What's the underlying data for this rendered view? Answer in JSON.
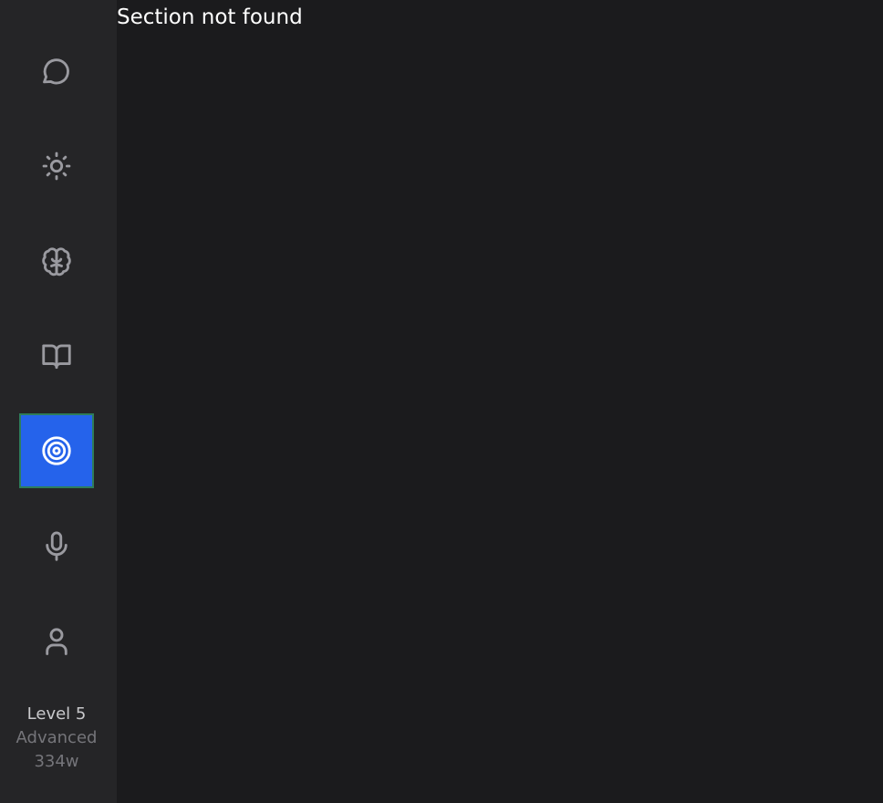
{
  "sidebar": {
    "items": [
      {
        "icon": "chat-bubble-icon",
        "active": false
      },
      {
        "icon": "sun-icon",
        "active": false
      },
      {
        "icon": "brain-icon",
        "active": false
      },
      {
        "icon": "open-book-icon",
        "active": false
      },
      {
        "icon": "target-icon",
        "active": true
      },
      {
        "icon": "microphone-icon",
        "active": false
      },
      {
        "icon": "user-icon",
        "active": false
      }
    ],
    "level": {
      "title": "Level 5",
      "tier": "Advanced",
      "words": "334w"
    },
    "accent_color": "#2563eb"
  },
  "main": {
    "message": "Section not found"
  }
}
